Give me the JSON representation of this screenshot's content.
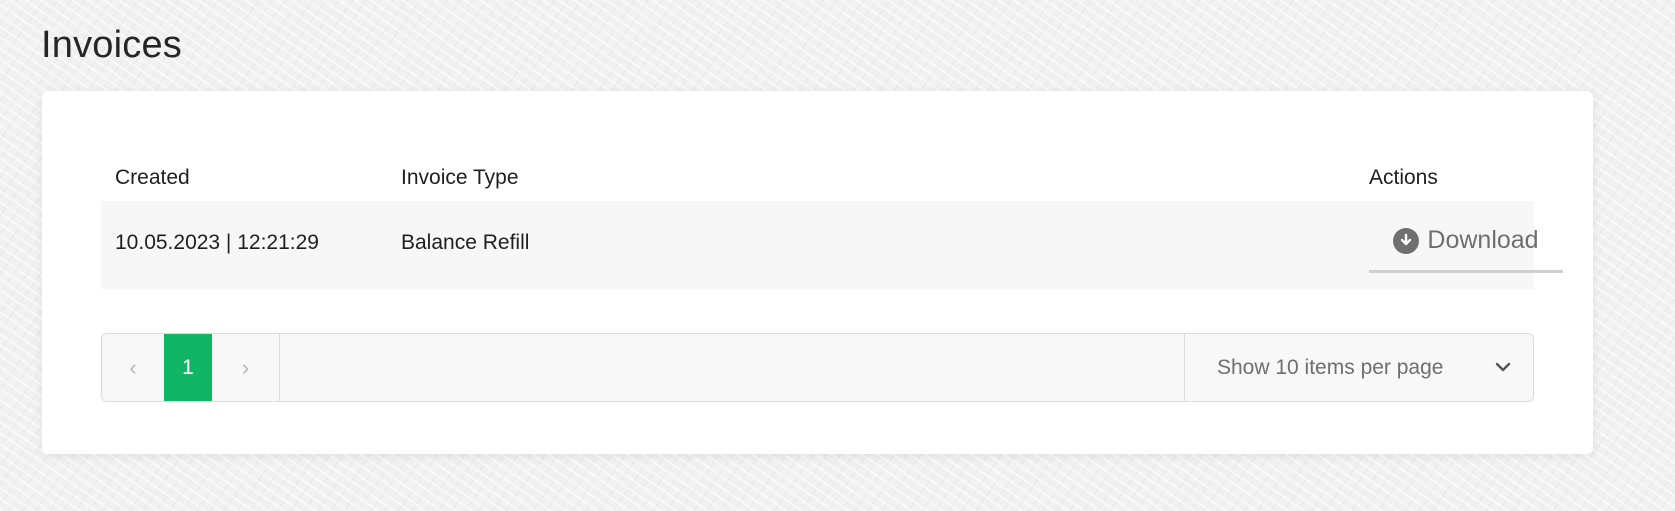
{
  "page": {
    "title": "Invoices"
  },
  "table": {
    "columns": [
      "Created",
      "Invoice Type",
      "Actions"
    ],
    "rows": [
      {
        "created": "10.05.2023 | 12:21:29",
        "type": "Balance Refill",
        "action_label": "Download",
        "action_icon": "download-circle-icon"
      }
    ]
  },
  "pagination": {
    "prev_symbol": "‹",
    "current_page": "1",
    "next_symbol": "›",
    "per_page_label": "Show 10 items per page",
    "per_page_icon": "chevron-down-icon"
  },
  "colors": {
    "accent": "#10b565",
    "muted_text": "#6f6f6f",
    "row_bg": "#f7f7f7"
  }
}
